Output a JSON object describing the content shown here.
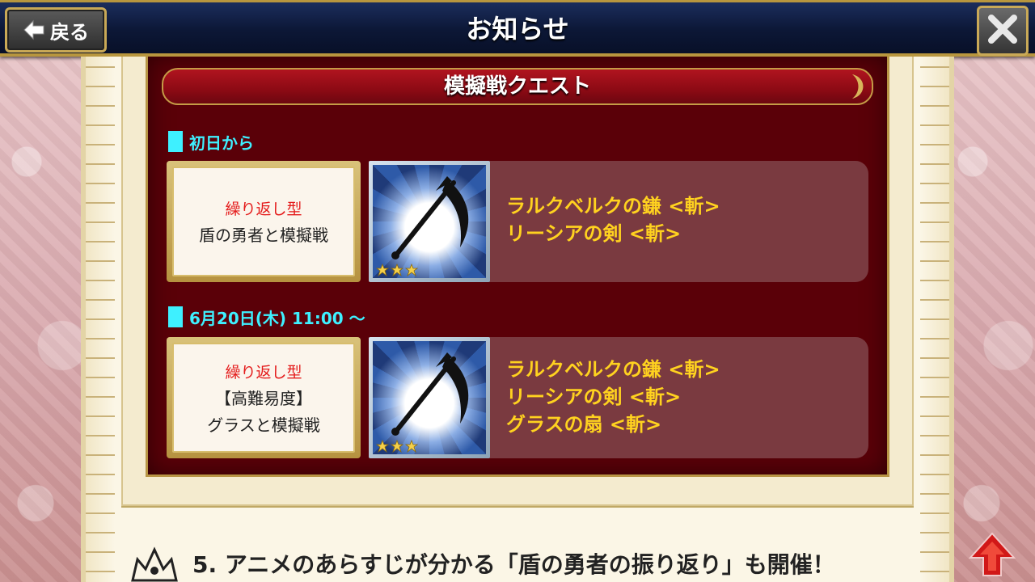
{
  "header": {
    "title": "お知らせ",
    "back_label": "戻る"
  },
  "section": {
    "title": "模擬戦クエスト",
    "groups": [
      {
        "heading": "初日から",
        "quest_type": "繰り返し型",
        "quest_name_lines": [
          "盾の勇者と模擬戦"
        ],
        "rarity_stars": 3,
        "rewards": [
          "ラルクベルクの鎌 <斬>",
          "リーシアの剣 <斬>"
        ]
      },
      {
        "heading": "6月20日(木) 11:00 ～",
        "quest_type": "繰り返し型",
        "quest_name_lines": [
          "【高難易度】",
          "グラスと模擬戦"
        ],
        "rarity_stars": 3,
        "rewards": [
          "ラルクベルクの鎌 <斬>",
          "リーシアの剣 <斬>",
          "グラスの扇 <斬>"
        ]
      }
    ]
  },
  "next_section_heading": "5. アニメのあらすじが分かる「盾の勇者の振り返り」も開催！",
  "colors": {
    "accent_cyan": "#3ef0ff",
    "reward_yellow": "#ffd21f",
    "quest_type_red": "#e41b1b",
    "header_navy": "#0c1736",
    "gold_border": "#b8963e"
  },
  "icons": {
    "back": "left-arrow-icon",
    "close": "close-icon",
    "weapon": "scythe-icon",
    "scroll_top": "up-arrow-icon"
  }
}
